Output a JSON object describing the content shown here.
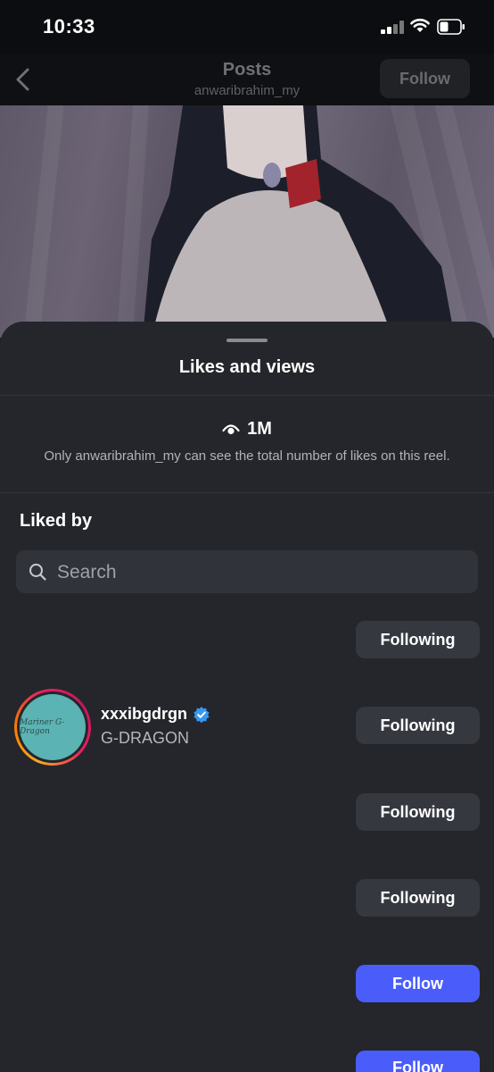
{
  "status_bar": {
    "time": "10:33"
  },
  "header": {
    "title": "Posts",
    "subtitle": "anwaribrahim_my",
    "follow_label": "Follow"
  },
  "sheet": {
    "title": "Likes and views",
    "views_count": "1M",
    "views_note": "Only anwaribrahim_my can see the total number of likes on this reel.",
    "liked_by_label": "Liked by",
    "search_placeholder": "Search"
  },
  "users": [
    {
      "username": "",
      "fullname": "",
      "button": "Following"
    },
    {
      "username": "xxxibgdrgn",
      "fullname": "G-DRAGON",
      "verified": true,
      "avatar_text": "Mariner G-Dragon",
      "button": "Following"
    },
    {
      "username": "",
      "fullname": "",
      "button": "Following"
    },
    {
      "username": "",
      "fullname": "",
      "button": "Following"
    },
    {
      "username": "",
      "fullname": "",
      "button": "Follow"
    },
    {
      "username": "",
      "fullname": "",
      "button": "Follow"
    }
  ],
  "colors": {
    "follow_button": "#4a5dfa",
    "following_button": "#363840",
    "verified_badge": "#3897f0"
  }
}
